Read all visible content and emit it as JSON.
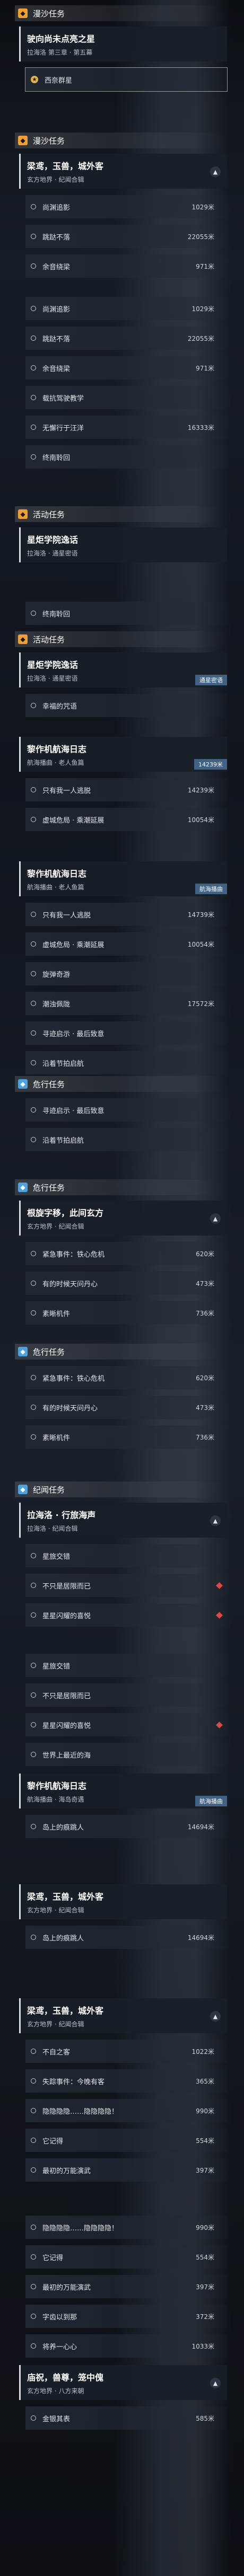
{
  "colors": {
    "orange": "#f0a030",
    "blue": "#4aa3e0",
    "tag": "#466e96",
    "warn": "#e04848"
  },
  "s1": {
    "header": "漫沙任务",
    "card": {
      "title": "驶向尚未点亮之星",
      "sub": "拉海洛 第三章 · 第五幕"
    },
    "goal": "西奈群星"
  },
  "s2": {
    "header": "漫沙任务",
    "card": {
      "title": "梁鸢，玉兽，城外客",
      "sub": "玄方地界 · 纪闻合辑"
    },
    "rows": [
      {
        "label": "尚渊追影",
        "dist": "1029米"
      },
      {
        "label": "跳跶不落",
        "dist": "22055米"
      },
      {
        "label": "余音绕梁",
        "dist": "971米"
      }
    ]
  },
  "s3": {
    "rows": [
      {
        "label": "尚渊追影",
        "dist": "1029米"
      },
      {
        "label": "跳跶不落",
        "dist": "22055米"
      },
      {
        "label": "余音绕梁",
        "dist": "971米"
      },
      {
        "label": "载抗驾驶教学",
        "dist": ""
      },
      {
        "label": "无懈行于汪洋",
        "dist": "16333米"
      },
      {
        "label": "终南聆回",
        "dist": ""
      }
    ]
  },
  "s4": {
    "header": "活动任务",
    "card": {
      "title": "星炬学院逸话",
      "sub": "拉海洛 · 通星密语"
    }
  },
  "s5": {
    "rows": [
      {
        "label": "终南聆回",
        "dist": ""
      }
    ],
    "header": "活动任务",
    "card": {
      "title": "星炬学院逸话",
      "sub": "拉海洛 · 通星密语",
      "tag": "通星密语"
    },
    "rows2": [
      {
        "label": "幸福的咒语",
        "dist": ""
      }
    ]
  },
  "s6": {
    "card": {
      "title": "黎作机航海日志",
      "sub": "航海播曲 · 老人鱼篇",
      "tag": "14239米"
    },
    "rows": [
      {
        "label": "只有我一人逃脱",
        "dist": "14239米"
      },
      {
        "label": "虚城危局 · 乘潮延展",
        "dist": "10054米"
      }
    ]
  },
  "s7": {
    "card": {
      "title": "黎作机航海日志",
      "sub": "航海播曲 · 老人鱼篇",
      "tag": "航海播曲"
    },
    "rows": [
      {
        "label": "只有我一人逃脱",
        "dist": "14739米"
      },
      {
        "label": "虚城危局 · 乘潮延展",
        "dist": "10054米"
      },
      {
        "label": "旋弹奇游",
        "dist": ""
      },
      {
        "label": "潮浊佩陇",
        "dist": "17572米"
      },
      {
        "label": "寻迹启示 · 最后致意",
        "dist": ""
      },
      {
        "label": "沿着节拍启航",
        "dist": ""
      }
    ]
  },
  "s8": {
    "header": "危行任务",
    "rows": [
      {
        "label": "寻迹启示 · 最后致意",
        "dist": ""
      },
      {
        "label": "沿着节拍启航",
        "dist": ""
      }
    ]
  },
  "s9": {
    "header": "危行任务",
    "card": {
      "title": "根旋字移，此间玄方",
      "sub": "玄方地界 · 纪闻合辑"
    },
    "rows": [
      {
        "label": "紧急事件：铁心危机",
        "dist": "620米"
      },
      {
        "label": "有的时候天问丹心",
        "dist": "473米"
      },
      {
        "label": "素晰机件",
        "dist": "736米"
      }
    ]
  },
  "s10": {
    "header": "危行任务",
    "rows": [
      {
        "label": "紧急事件：铁心危机",
        "dist": "620米"
      },
      {
        "label": "有的时候天问丹心",
        "dist": "473米"
      },
      {
        "label": "素晰机件",
        "dist": "736米"
      }
    ]
  },
  "s11": {
    "header": "纪闻任务",
    "card": {
      "title": "拉海洛 · 行旅海声",
      "sub": "拉海洛 · 纪闻合辑"
    },
    "rows": [
      {
        "label": "星旅交错",
        "dist": ""
      },
      {
        "label": "不只是居限而已",
        "dist": ""
      },
      {
        "label": "星星闪耀的喜悦",
        "dist": ""
      }
    ]
  },
  "s12": {
    "rows": [
      {
        "label": "星旅交错",
        "dist": ""
      },
      {
        "label": "不只是居限而已",
        "dist": ""
      },
      {
        "label": "星星闪耀的喜悦",
        "dist": ""
      },
      {
        "label": "世界上最近的海",
        "dist": ""
      }
    ],
    "card": {
      "title": "黎作机航海日志",
      "sub": "航海播曲 · 海岛奇遇",
      "tag": "航海播曲"
    },
    "rows2": [
      {
        "label": "岛上的痕跳人",
        "dist": "14694米"
      }
    ]
  },
  "s13": {
    "card": {
      "title": "梁鸢，玉兽，城外客",
      "sub": "玄方地界 · 纪闻合辑"
    },
    "row": {
      "label": "岛上的痕跳人",
      "dist": "14694米"
    }
  },
  "s14": {
    "card": {
      "title": "梁鸢，玉兽，城外客",
      "sub": "玄方地界 · 纪闻合辑"
    },
    "rows": [
      {
        "label": "不自之客",
        "dist": "1022米"
      },
      {
        "label": "失踪事件：今晚有客",
        "dist": "365米"
      },
      {
        "label": "隐隐隐隐……隐隐隐隐！",
        "dist": "990米"
      },
      {
        "label": "它记得",
        "dist": "554米"
      },
      {
        "label": "最初的万能演武",
        "dist": "397米"
      }
    ]
  },
  "s15": {
    "rows": [
      {
        "label": "隐隐隐隐……隐隐隐隐！",
        "dist": "990米"
      },
      {
        "label": "它记得",
        "dist": "554米"
      },
      {
        "label": "最初的万能演武",
        "dist": "397米"
      },
      {
        "label": "字齿以到那",
        "dist": "372米"
      },
      {
        "label": "将养一心心",
        "dist": "1033米"
      }
    ],
    "card": {
      "title": "庙祝，兽尊，笼中傀",
      "sub": "玄方地界 · 八方来朝"
    },
    "rows2": [
      {
        "label": "金银其表",
        "dist": "585米"
      }
    ]
  }
}
